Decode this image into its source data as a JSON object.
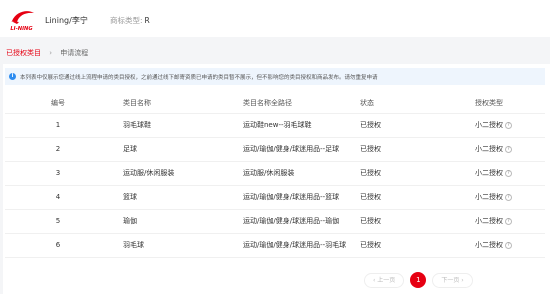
{
  "header": {
    "brand_logo_text": "LI-NING",
    "brand_name": "Lining/李宁",
    "brand_type_label": "商标类型:",
    "brand_type_value": "R"
  },
  "breadcrumb": {
    "item1": "已授权类目",
    "separator": "›",
    "item2": "申请流程"
  },
  "notice": {
    "icon": "info-icon",
    "text": "本列表中仅展示您通过线上流程申请的类目授权，之前通过线下邮寄资质已申请的类目暂不展示，但不影响您的类目授权和商品发布。请勿重复申请"
  },
  "table": {
    "headers": [
      "编号",
      "类目名称",
      "类目名称全路径",
      "状态",
      "授权类型"
    ],
    "rows": [
      {
        "no": "1",
        "name": "羽毛球鞋",
        "path": "运动鞋new--羽毛球鞋",
        "status": "已授权",
        "type": "小二授权"
      },
      {
        "no": "2",
        "name": "足球",
        "path": "运动/瑜伽/健身/球迷用品--足球",
        "status": "已授权",
        "type": "小二授权"
      },
      {
        "no": "3",
        "name": "运动服/休闲服装",
        "path": "运动服/休闲服装",
        "status": "已授权",
        "type": "小二授权"
      },
      {
        "no": "4",
        "name": "篮球",
        "path": "运动/瑜伽/健身/球迷用品--篮球",
        "status": "已授权",
        "type": "小二授权"
      },
      {
        "no": "5",
        "name": "瑜伽",
        "path": "运动/瑜伽/健身/球迷用品--瑜伽",
        "status": "已授权",
        "type": "小二授权"
      },
      {
        "no": "6",
        "name": "羽毛球",
        "path": "运动/瑜伽/健身/球迷用品--羽毛球",
        "status": "已授权",
        "type": "小二授权"
      }
    ]
  },
  "pagination": {
    "prev": "‹ 上一页",
    "current": "1",
    "next": "下一页 ›"
  },
  "colors": {
    "brand_red": "#e60012",
    "info_blue": "#2d8cf0"
  }
}
